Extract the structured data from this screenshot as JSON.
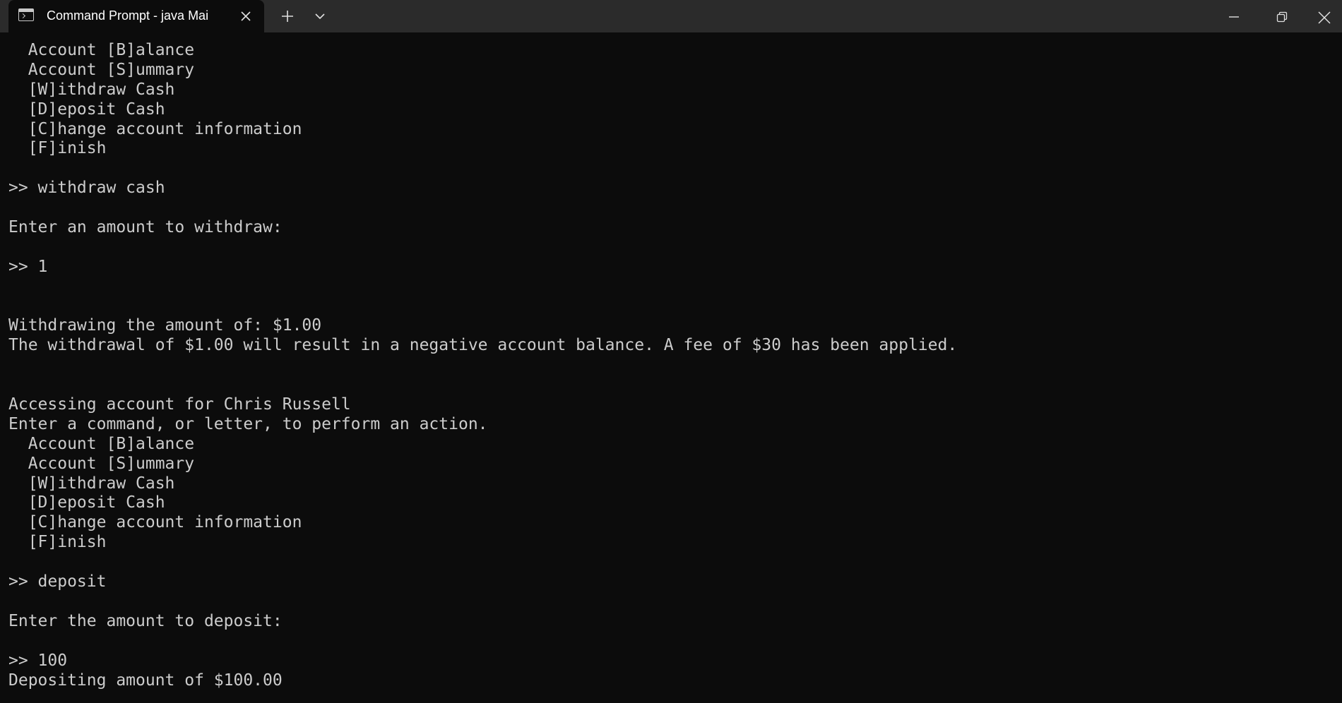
{
  "window": {
    "tab_title": "Command Prompt - java  Mai"
  },
  "terminal": {
    "lines": [
      "  Account [B]alance",
      "  Account [S]ummary",
      "  [W]ithdraw Cash",
      "  [D]eposit Cash",
      "  [C]hange account information",
      "  [F]inish",
      "",
      ">> withdraw cash",
      "",
      "Enter an amount to withdraw:",
      "",
      ">> 1",
      "",
      "",
      "Withdrawing the amount of: $1.00",
      "The withdrawal of $1.00 will result in a negative account balance. A fee of $30 has been applied.",
      "",
      "",
      "Accessing account for Chris Russell",
      "Enter a command, or letter, to perform an action.",
      "  Account [B]alance",
      "  Account [S]ummary",
      "  [W]ithdraw Cash",
      "  [D]eposit Cash",
      "  [C]hange account information",
      "  [F]inish",
      "",
      ">> deposit",
      "",
      "Enter the amount to deposit:",
      "",
      ">> 100",
      "Depositing amount of $100.00"
    ]
  },
  "icons": {
    "tab_icon": "terminal-icon",
    "tab_close": "close-icon",
    "new_tab": "plus-icon",
    "dropdown": "chevron-down-icon",
    "minimize": "minimize-icon",
    "restore": "restore-icon",
    "close": "close-icon"
  },
  "colors": {
    "titlebar": "#2b2b2b",
    "background": "#0c0c0c",
    "text": "#cccccc"
  }
}
